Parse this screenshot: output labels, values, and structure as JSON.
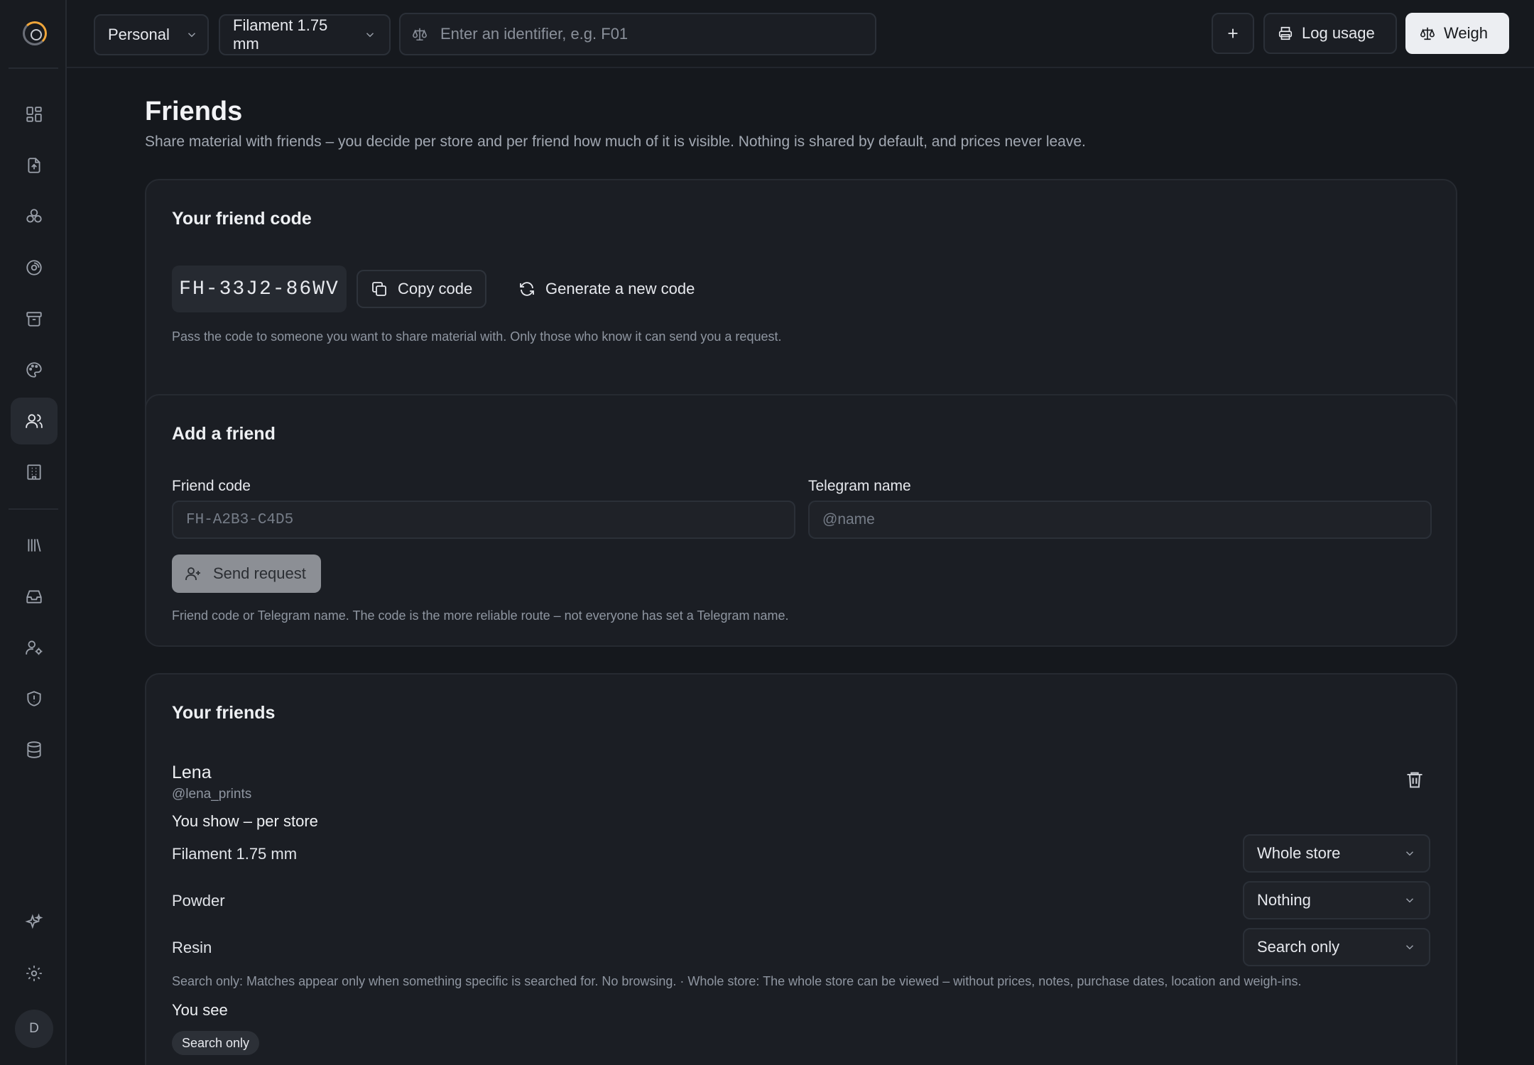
{
  "topbar": {
    "workspace": "Personal",
    "store": "Filament 1.75 mm",
    "search_placeholder": "Enter an identifier, e.g. F01",
    "log_usage": "Log usage",
    "weigh": "Weigh"
  },
  "sidebar": {
    "items": [
      {
        "icon": "dashboard-icon"
      },
      {
        "icon": "import-file-icon"
      },
      {
        "icon": "materials-icon"
      },
      {
        "icon": "spool-icon"
      },
      {
        "icon": "archive-icon"
      },
      {
        "icon": "palette-icon"
      },
      {
        "icon": "friends-icon",
        "active": true
      },
      {
        "icon": "building-icon"
      },
      {
        "icon": "library-icon"
      },
      {
        "icon": "inbox-icon"
      },
      {
        "icon": "user-settings-icon"
      },
      {
        "icon": "shield-icon"
      },
      {
        "icon": "database-icon"
      },
      {
        "icon": "sparkles-icon"
      },
      {
        "icon": "settings-icon"
      }
    ],
    "avatar_initial": "D"
  },
  "page": {
    "title": "Friends",
    "subtitle": "Share material with friends – you decide per store and per friend how much of it is visible. Nothing is shared by default, and prices never leave."
  },
  "friend_code_card": {
    "title": "Your friend code",
    "code": "FH-33J2-86WV",
    "copy_label": "Copy code",
    "generate_label": "Generate a new code",
    "hint": "Pass the code to someone you want to share material with. Only those who know it can send you a request."
  },
  "add_friend_card": {
    "title": "Add a friend",
    "code_label": "Friend code",
    "code_placeholder": "FH-A2B3-C4D5",
    "telegram_label": "Telegram name",
    "telegram_placeholder": "@name",
    "send_label": "Send request",
    "hint": "Friend code or Telegram name. The code is the more reliable route – not everyone has set a Telegram name."
  },
  "friends_card": {
    "title": "Your friends",
    "friends": [
      {
        "name": "Lena",
        "handle": "@lena_prints",
        "you_show_label": "You show – per store",
        "stores": [
          {
            "name": "Filament 1.75 mm",
            "visibility": "Whole store"
          },
          {
            "name": "Powder",
            "visibility": "Nothing"
          },
          {
            "name": "Resin",
            "visibility": "Search only"
          }
        ],
        "legend": "Search only: Matches appear only when something specific is searched for. No browsing. · Whole store: The whole store can be viewed – without prices, notes, purchase dates, location and weigh-ins.",
        "you_see_label": "You see",
        "you_see_value": "Search only"
      }
    ]
  }
}
